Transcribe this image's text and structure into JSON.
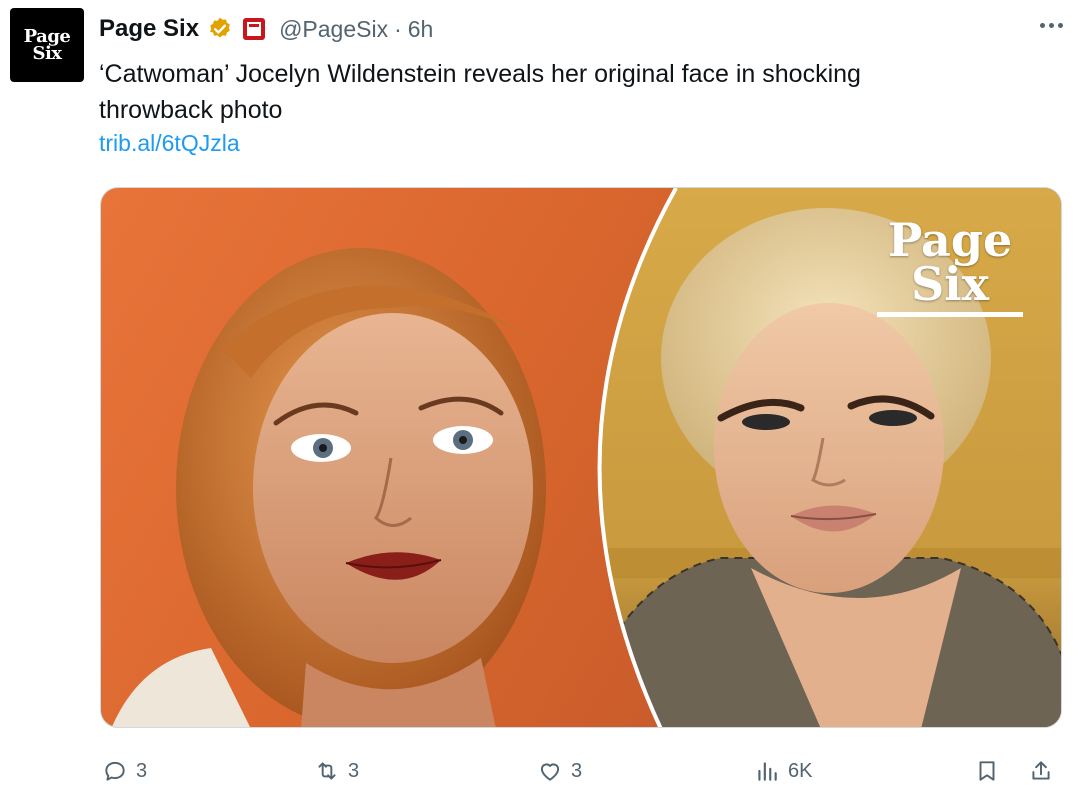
{
  "account": {
    "avatar_text_line1": "Page",
    "avatar_text_line2": "Six",
    "display_name": "Page Six",
    "handle": "@PageSix",
    "separator": "·",
    "time": "6h"
  },
  "tweet": {
    "text": "‘Catwoman’ Jocelyn Wildenstein reveals her original face in shocking throwback photo",
    "link": "trib.al/6tQJzla"
  },
  "media": {
    "watermark_line1": "Page",
    "watermark_line2": "Six"
  },
  "actions": {
    "replies": "3",
    "reposts": "3",
    "likes": "3",
    "views": "6K"
  },
  "colors": {
    "link": "#1d9bf0",
    "verified_badge": "#e2a300",
    "affiliate_badge": "#c7161d",
    "secondary_text": "#536471"
  }
}
